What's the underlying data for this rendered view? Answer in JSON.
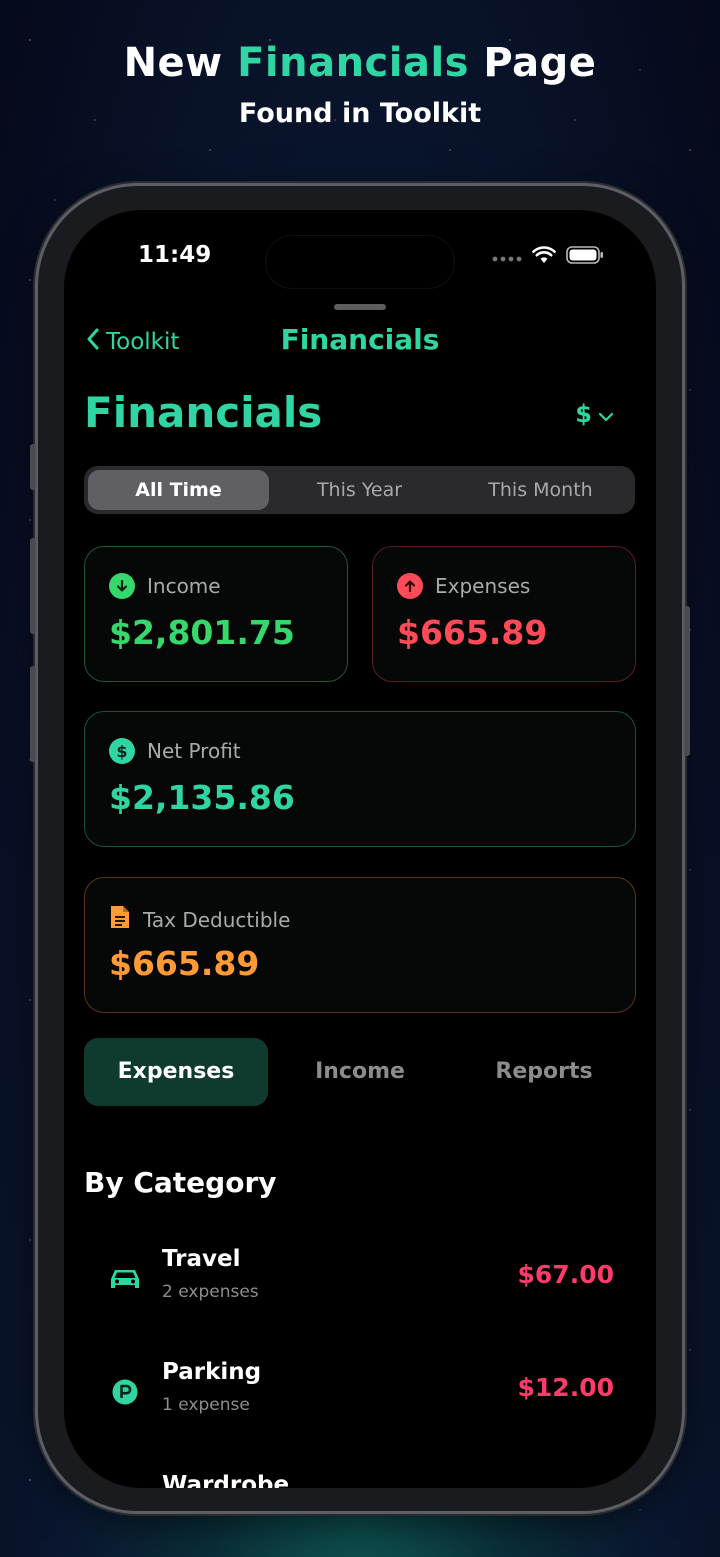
{
  "promo": {
    "title_before": "New ",
    "title_accent": "Financials",
    "title_after": " Page",
    "subtitle": "Found in Toolkit"
  },
  "status_bar": {
    "time": "11:49"
  },
  "nav": {
    "back_label": "Toolkit",
    "title": "Financials"
  },
  "header": {
    "title": "Financials",
    "currency": "$"
  },
  "period_segments": [
    {
      "label": "All Time",
      "selected": true
    },
    {
      "label": "This Year",
      "selected": false
    },
    {
      "label": "This Month",
      "selected": false
    }
  ],
  "summary": {
    "income": {
      "label": "Income",
      "amount": "$2,801.75",
      "color": "#35d86a"
    },
    "expenses": {
      "label": "Expenses",
      "amount": "$665.89",
      "color": "#ff4a58"
    },
    "net_profit": {
      "label": "Net Profit",
      "amount": "$2,135.86",
      "color": "#2fd6a3"
    },
    "tax_deductible": {
      "label": "Tax Deductible",
      "amount": "$665.89",
      "color": "#ff9a36"
    }
  },
  "tabs": [
    {
      "label": "Expenses",
      "selected": true
    },
    {
      "label": "Income",
      "selected": false
    },
    {
      "label": "Reports",
      "selected": false
    }
  ],
  "by_category": {
    "title": "By Category",
    "items": [
      {
        "name": "Travel",
        "count": "2 expenses",
        "amount": "$67.00",
        "icon": "car-icon"
      },
      {
        "name": "Parking",
        "count": "1 expense",
        "amount": "$12.00",
        "icon": "parking-icon"
      },
      {
        "name": "Wardrobe",
        "count": "",
        "amount": "",
        "icon": "hanger-icon"
      }
    ]
  },
  "colors": {
    "accent": "#2fd6a3",
    "expense_red": "#ff3b6b"
  }
}
